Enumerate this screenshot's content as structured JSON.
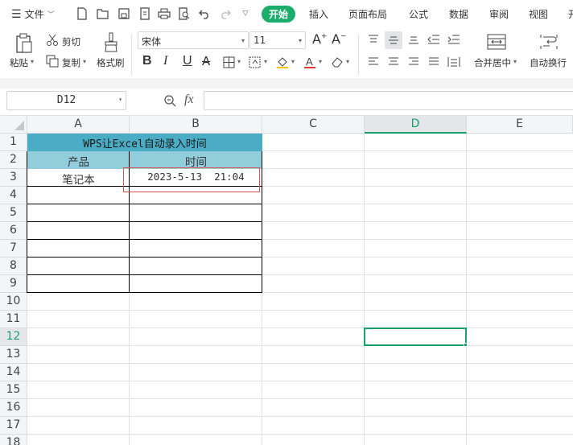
{
  "menubar": {
    "file_label": "文件",
    "tabs": [
      "开始",
      "插入",
      "页面布局",
      "公式",
      "数据",
      "审阅",
      "视图",
      "开"
    ]
  },
  "ribbon": {
    "paste": "粘贴",
    "cut": "剪切",
    "copy": "复制",
    "format_painter": "格式刷",
    "font_name": "宋体",
    "font_size": "11",
    "merge_center": "合并居中",
    "wrap_text": "自动换行",
    "bold": "B",
    "italic": "I",
    "underline": "U"
  },
  "formula_bar": {
    "name_box": "D12",
    "fx": "fx",
    "formula": ""
  },
  "grid": {
    "columns": [
      "A",
      "B",
      "C",
      "D",
      "E"
    ],
    "rows": [
      "1",
      "2",
      "3",
      "4",
      "5",
      "6",
      "7",
      "8",
      "9",
      "10",
      "11",
      "12",
      "13",
      "14",
      "15",
      "16",
      "17",
      "18"
    ],
    "selected_cell": "D12",
    "cells": {
      "A1": "WPS让Excel自动录入时间",
      "A2": "产品",
      "B2": "时间",
      "A3": "笔记本",
      "B3": "2023-5-13  21:04"
    }
  },
  "colors": {
    "accent": "#1aad6b",
    "header_row1": "#4bacc6",
    "header_row2": "#92cddc",
    "highlight_border": "#e05050"
  }
}
